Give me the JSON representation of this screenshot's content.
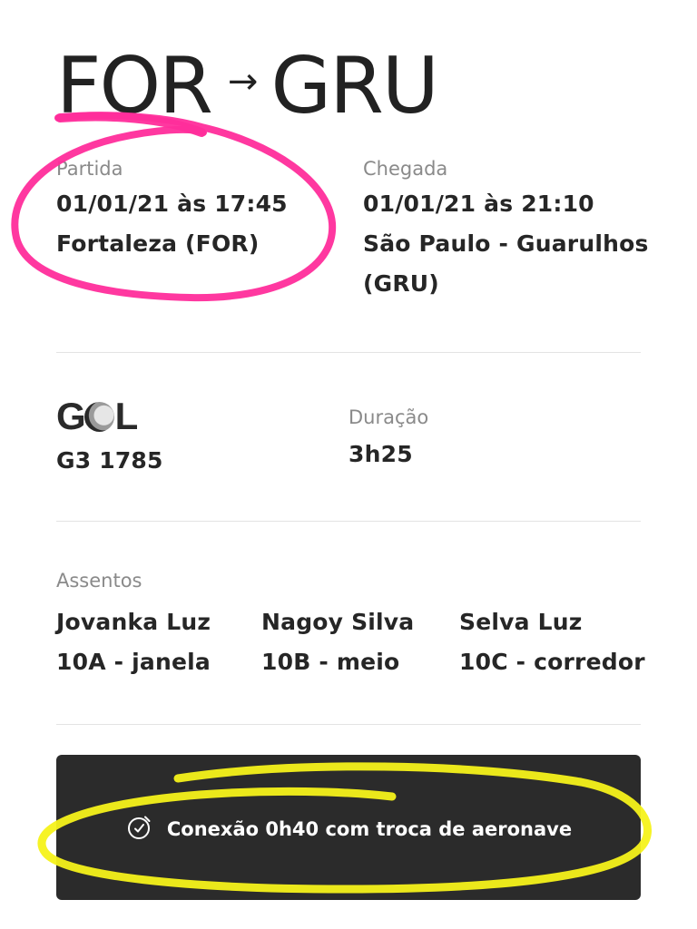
{
  "route": {
    "origin": "FOR",
    "arrow": "→",
    "destination": "GRU"
  },
  "departure": {
    "label": "Partida",
    "datetime": "01/01/21 às 17:45",
    "place": "Fortaleza (FOR)"
  },
  "arrival": {
    "label": "Chegada",
    "datetime": "01/01/21 às 21:10",
    "place_line1": "São Paulo - Guarulhos",
    "place_line2": "(GRU)"
  },
  "flight": {
    "airline_logo": "GOL",
    "number": "G3 1785",
    "duration_label": "Duração",
    "duration": "3h25"
  },
  "seats": {
    "label": "Assentos",
    "passengers": [
      {
        "name": "Jovanka Luz",
        "seat": "10A - janela"
      },
      {
        "name": "Nagoy Silva",
        "seat": "10B - meio"
      },
      {
        "name": "Selva Luz",
        "seat": "10C - corredor"
      }
    ]
  },
  "connection": {
    "icon": "clock-icon",
    "text": "Conexão 0h40 com troca de aeronave"
  },
  "colors": {
    "pink_marker": "#ff2d9b",
    "yellow_marker": "#f6f21a",
    "banner_bg": "#2b2b2b"
  }
}
